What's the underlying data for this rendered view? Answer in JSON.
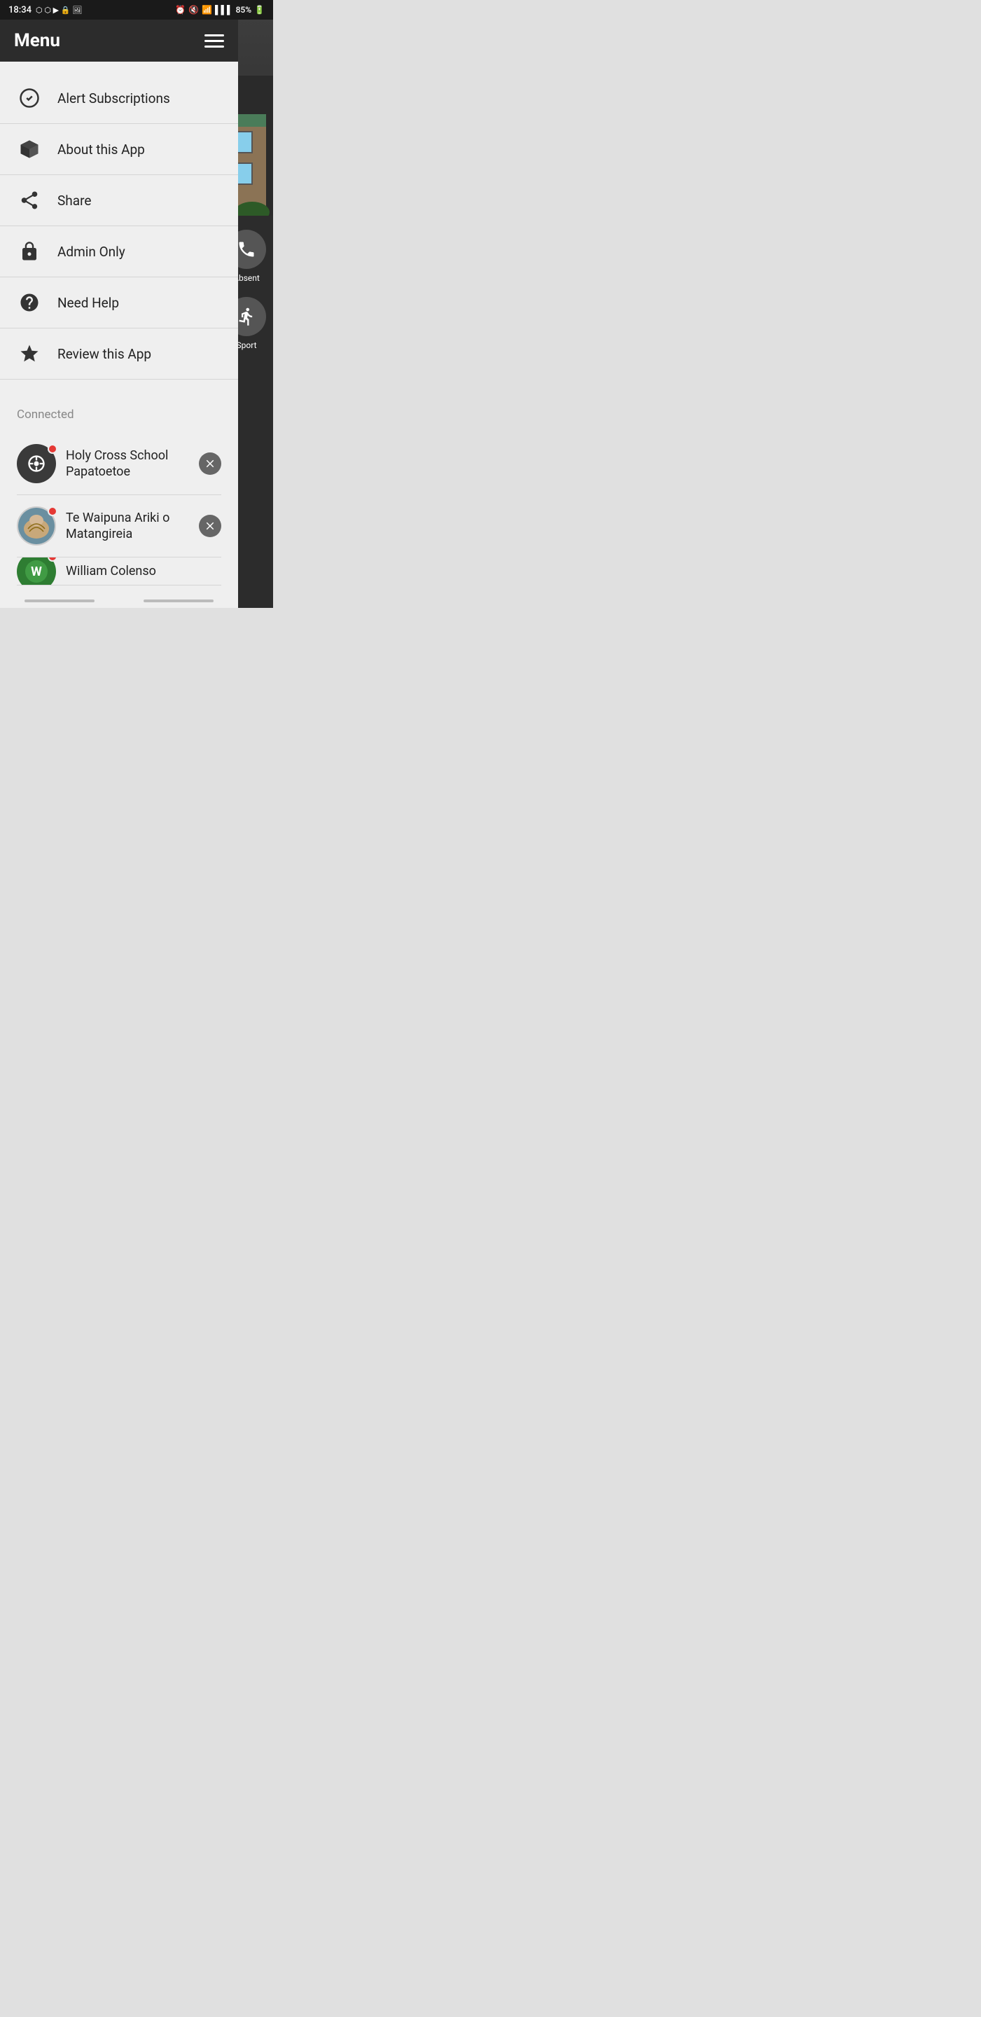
{
  "statusBar": {
    "time": "18:34",
    "batteryPercent": "85%"
  },
  "header": {
    "title": "Menu",
    "hamburgerLabel": "menu-icon"
  },
  "menuItems": [
    {
      "id": "alert-subscriptions",
      "label": "Alert Subscriptions",
      "icon": "checkmark-circle"
    },
    {
      "id": "about-app",
      "label": "About this App",
      "icon": "cube"
    },
    {
      "id": "share",
      "label": "Share",
      "icon": "share"
    },
    {
      "id": "admin-only",
      "label": "Admin Only",
      "icon": "lock"
    },
    {
      "id": "need-help",
      "label": "Need Help",
      "icon": "help-circle"
    },
    {
      "id": "review-app",
      "label": "Review this App",
      "icon": "star"
    }
  ],
  "connectedSection": {
    "title": "Connected",
    "schools": [
      {
        "id": "holy-cross",
        "name": "Holy Cross School Papatoetoe",
        "hasNotification": true,
        "avatarType": "cross"
      },
      {
        "id": "te-waipuna",
        "name": "Te Waipuna Ariki o Matangireia",
        "hasNotification": true,
        "avatarType": "shell"
      },
      {
        "id": "william-colenso",
        "name": "William Colenso",
        "hasNotification": true,
        "avatarType": "green"
      }
    ]
  },
  "bgActions": [
    {
      "id": "absent",
      "label": "Absent",
      "icon": "phone"
    },
    {
      "id": "sport",
      "label": "Sport",
      "icon": "running"
    }
  ]
}
